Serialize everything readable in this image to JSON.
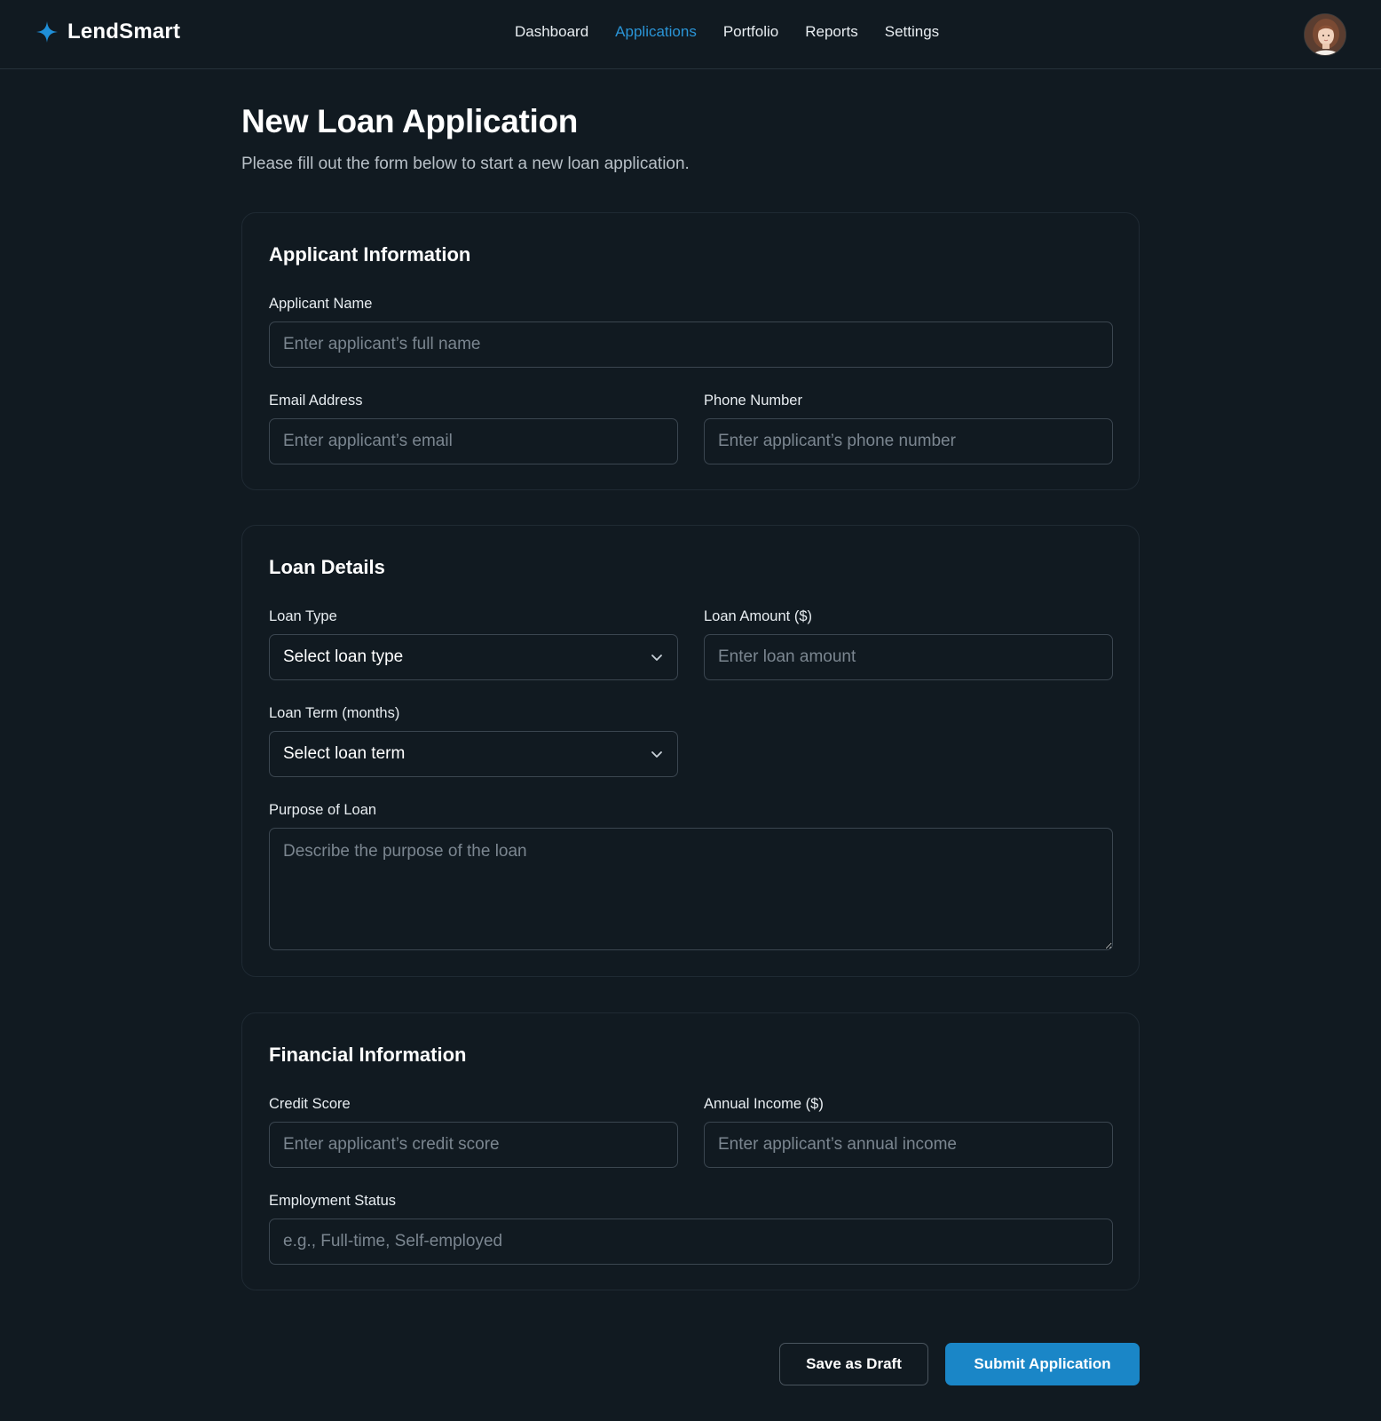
{
  "brand": {
    "name": "LendSmart"
  },
  "nav": {
    "items": [
      {
        "label": "Dashboard",
        "active": false
      },
      {
        "label": "Applications",
        "active": true
      },
      {
        "label": "Portfolio",
        "active": false
      },
      {
        "label": "Reports",
        "active": false
      },
      {
        "label": "Settings",
        "active": false
      }
    ]
  },
  "page": {
    "title": "New Loan Application",
    "subtitle": "Please fill out the form below to start a new loan application."
  },
  "applicant": {
    "title": "Applicant Information",
    "name_label": "Applicant Name",
    "name_placeholder": "Enter applicant’s full name",
    "email_label": "Email Address",
    "email_placeholder": "Enter applicant’s email",
    "phone_label": "Phone Number",
    "phone_placeholder": "Enter applicant’s phone number"
  },
  "loan": {
    "title": "Loan Details",
    "type_label": "Loan Type",
    "type_value": "Select loan type",
    "amount_label": "Loan Amount ($)",
    "amount_placeholder": "Enter loan amount",
    "term_label": "Loan Term (months)",
    "term_value": "Select loan term",
    "purpose_label": "Purpose of Loan",
    "purpose_placeholder": "Describe the purpose of the loan"
  },
  "financial": {
    "title": "Financial Information",
    "credit_label": "Credit Score",
    "credit_placeholder": "Enter applicant’s credit score",
    "income_label": "Annual Income ($)",
    "income_placeholder": "Enter applicant’s annual income",
    "employment_label": "Employment Status",
    "employment_placeholder": "e.g., Full-time, Self-employed"
  },
  "actions": {
    "draft_label": "Save as Draft",
    "submit_label": "Submit Application"
  },
  "colors": {
    "background": "#111a21",
    "accent": "#2a94d6",
    "submit": "#1a86c7",
    "border": "#3b4650"
  },
  "icons": {
    "brand": "sparkle-icon",
    "select": "chevron-down-icon",
    "avatar": "user-avatar"
  }
}
